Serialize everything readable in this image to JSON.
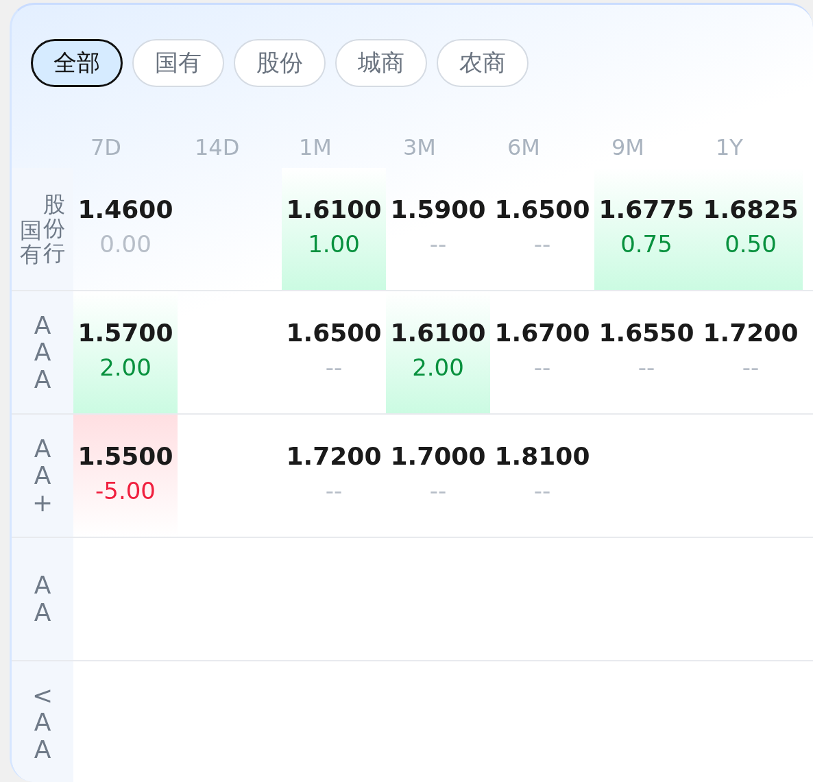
{
  "filters": [
    {
      "label": "全部",
      "selected": true
    },
    {
      "label": "国有",
      "selected": false
    },
    {
      "label": "股份",
      "selected": false
    },
    {
      "label": "城商",
      "selected": false
    },
    {
      "label": "农商",
      "selected": false
    }
  ],
  "columns": [
    "7D",
    "14D",
    "1M",
    "3M",
    "6M",
    "9M",
    "1Y"
  ],
  "rows": [
    {
      "label_parts": [
        "国有",
        "股份行"
      ],
      "cells": [
        {
          "kind": "flat",
          "value": "1.4600",
          "change": "0.00"
        },
        {
          "kind": "empty"
        },
        {
          "kind": "up",
          "value": "1.6100",
          "change": "1.00"
        },
        {
          "kind": "dash",
          "value": "1.5900",
          "change": "--"
        },
        {
          "kind": "dash",
          "value": "1.6500",
          "change": "--"
        },
        {
          "kind": "up",
          "value": "1.6775",
          "change": "0.75"
        },
        {
          "kind": "up",
          "value": "1.6825",
          "change": "0.50"
        }
      ]
    },
    {
      "label_parts": [
        "AAA"
      ],
      "cells": [
        {
          "kind": "up",
          "value": "1.5700",
          "change": "2.00"
        },
        {
          "kind": "empty"
        },
        {
          "kind": "dash",
          "value": "1.6500",
          "change": "--"
        },
        {
          "kind": "up",
          "value": "1.6100",
          "change": "2.00"
        },
        {
          "kind": "dash",
          "value": "1.6700",
          "change": "--"
        },
        {
          "kind": "dash",
          "value": "1.6550",
          "change": "--"
        },
        {
          "kind": "dash",
          "value": "1.7200",
          "change": "--"
        }
      ]
    },
    {
      "label_parts": [
        "AA+"
      ],
      "cells": [
        {
          "kind": "down",
          "value": "1.5500",
          "change": "-5.00"
        },
        {
          "kind": "empty"
        },
        {
          "kind": "dash",
          "value": "1.7200",
          "change": "--"
        },
        {
          "kind": "dash",
          "value": "1.7000",
          "change": "--"
        },
        {
          "kind": "dash",
          "value": "1.8100",
          "change": "--"
        },
        {
          "kind": "empty"
        },
        {
          "kind": "empty"
        }
      ]
    },
    {
      "label_parts": [
        "AA"
      ],
      "cells": []
    },
    {
      "label_parts": [
        "<AA"
      ],
      "cells": []
    }
  ]
}
